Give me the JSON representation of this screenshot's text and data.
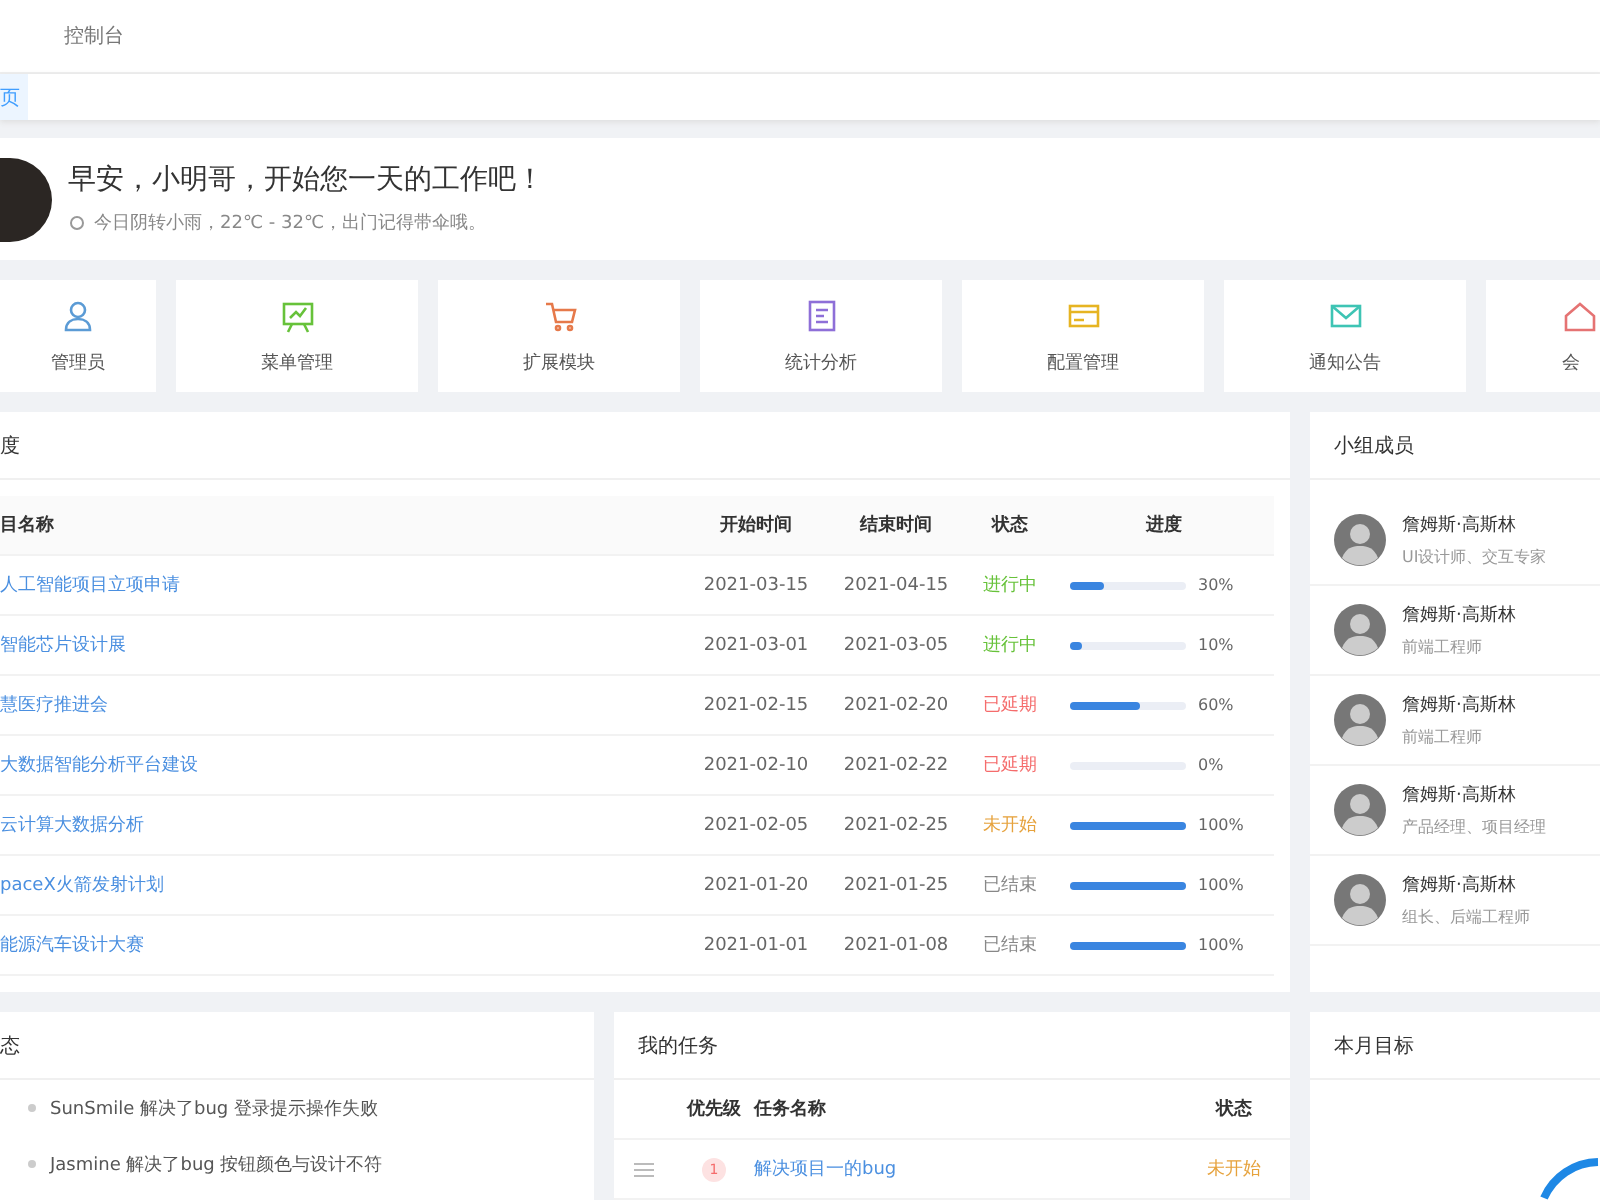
{
  "breadcrumb": "控制台",
  "tabs": [
    {
      "label": "页",
      "selected": true
    }
  ],
  "greeting": {
    "title": "早安，小明哥，开始您一天的工作吧！",
    "weather": "今日阴转小雨，22℃ - 32℃，出门记得带伞哦。"
  },
  "shortcuts": [
    {
      "label": "管理员"
    },
    {
      "label": "菜单管理"
    },
    {
      "label": "扩展模块"
    },
    {
      "label": "统计分析"
    },
    {
      "label": "配置管理"
    },
    {
      "label": "通知公告"
    },
    {
      "label": "会"
    }
  ],
  "projects": {
    "title": "度",
    "columns": [
      "目名称",
      "开始时间",
      "结束时间",
      "状态",
      "进度"
    ],
    "rows": [
      {
        "name": "人工智能项目立项申请",
        "start": "2021-03-15",
        "end": "2021-04-15",
        "status": "进行中",
        "kind": "active",
        "level": 0.3,
        "percent": "30%"
      },
      {
        "name": "智能芯片设计展",
        "start": "2021-03-01",
        "end": "2021-03-05",
        "status": "进行中",
        "kind": "active",
        "level": 0.1,
        "percent": "10%"
      },
      {
        "name": "慧医疗推进会",
        "start": "2021-02-15",
        "end": "2021-02-20",
        "status": "已延期",
        "kind": "late",
        "level": 0.6,
        "percent": "60%"
      },
      {
        "name": "大数据智能分析平台建设",
        "start": "2021-02-10",
        "end": "2021-02-22",
        "status": "已延期",
        "kind": "late",
        "level": 0,
        "percent": "0%"
      },
      {
        "name": "云计算大数据分析",
        "start": "2021-02-05",
        "end": "2021-02-25",
        "status": "未开始",
        "kind": "pending",
        "level": 1,
        "percent": "100%"
      },
      {
        "name": "paceX火箭发射计划",
        "start": "2021-01-20",
        "end": "2021-01-25",
        "status": "已结束",
        "kind": "done",
        "level": 1,
        "percent": "100%"
      },
      {
        "name": "能源汽车设计大赛",
        "start": "2021-01-01",
        "end": "2021-01-08",
        "status": "已结束",
        "kind": "done",
        "level": 1,
        "percent": "100%"
      }
    ]
  },
  "members": {
    "title": "小组成员",
    "items": [
      {
        "name": "詹姆斯·高斯林",
        "role": "UI设计师、交互专家"
      },
      {
        "name": "詹姆斯·高斯林",
        "role": "前端工程师"
      },
      {
        "name": "詹姆斯·高斯林",
        "role": "前端工程师"
      },
      {
        "name": "詹姆斯·高斯林",
        "role": "产品经理、项目经理"
      },
      {
        "name": "詹姆斯·高斯林",
        "role": "组长、后端工程师"
      }
    ]
  },
  "activity": {
    "title": "态",
    "items": [
      "SunSmile 解决了bug 登录提示操作失败",
      "Jasmine 解决了bug 按钮颜色与设计不符"
    ]
  },
  "tasks": {
    "title": "我的任务",
    "columns": [
      "优先级",
      "任务名称",
      "状态"
    ],
    "rows": [
      {
        "priority": "1",
        "name": "解决项目一的bug",
        "status": "未开始",
        "kind": "pending"
      }
    ]
  },
  "goal": {
    "title": "本月目标"
  }
}
